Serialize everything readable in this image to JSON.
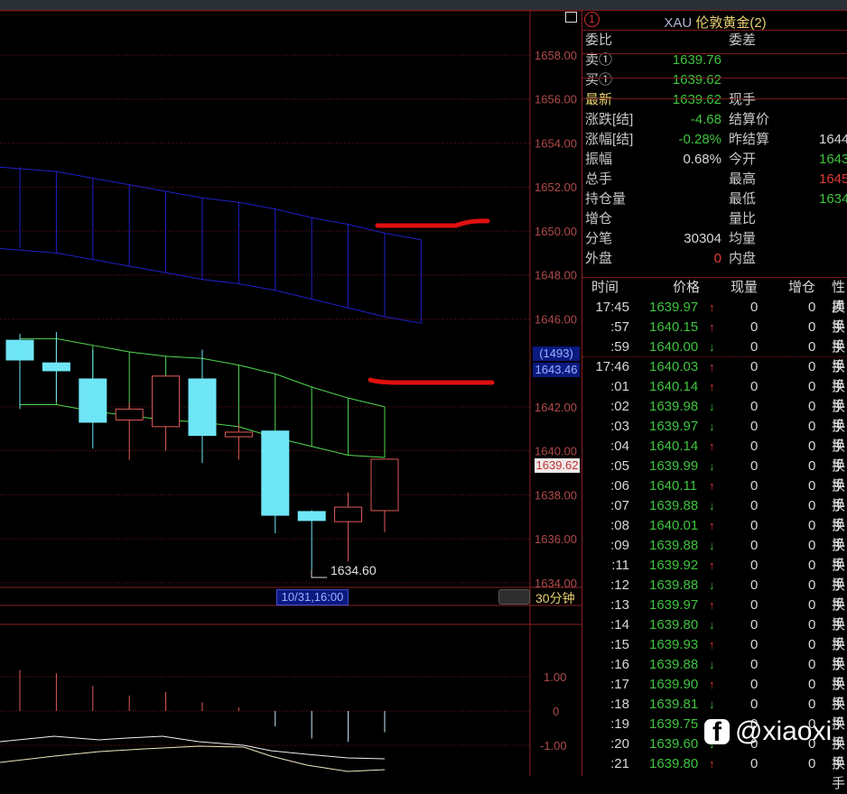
{
  "header": {
    "instrument_title_code": "XAU",
    "instrument_title_name": "伦敦黄金(2)",
    "window_index": "1"
  },
  "quote": {
    "rows": [
      {
        "l": "委比",
        "v": "",
        "l2": "委差",
        "v2": ""
      },
      {
        "l": "卖①",
        "v": "1639.76",
        "l2": "",
        "v2": ""
      },
      {
        "l": "买①",
        "v": "1639.62",
        "l2": "",
        "v2": ""
      },
      {
        "l": "最新",
        "v": "1639.62",
        "l2": "现手",
        "v2": ""
      },
      {
        "l": "涨跌[结]",
        "v": "-4.68",
        "l2": "结算价",
        "v2": ""
      },
      {
        "l": "涨幅[结]",
        "v": "-0.28%",
        "l2": "昨结算",
        "v2": "1644"
      },
      {
        "l": "振幅",
        "v": "0.68%",
        "l2": "今开",
        "v2": "1643"
      },
      {
        "l": "总手",
        "v": "",
        "l2": "最高",
        "v2": "1645"
      },
      {
        "l": "持仓量",
        "v": "",
        "l2": "最低",
        "v2": "1634"
      },
      {
        "l": "增仓",
        "v": "",
        "l2": "量比",
        "v2": ""
      },
      {
        "l": "分笔",
        "v": "30304",
        "l2": "均量",
        "v2": ""
      },
      {
        "l": "外盘",
        "v": "0",
        "l2": "内盘",
        "v2": ""
      }
    ]
  },
  "trades": {
    "headers": [
      "时间",
      "价格",
      "现量",
      "增仓",
      "性质"
    ],
    "rows": [
      [
        "17:45",
        "1639.97",
        "↑",
        "0",
        "0",
        "换手"
      ],
      [
        ":57",
        "1640.15",
        "↑",
        "0",
        "0",
        "换手"
      ],
      [
        ":59",
        "1640.00",
        "↓",
        "0",
        "0",
        "换手"
      ],
      [
        "17:46",
        "1640.03",
        "↑",
        "0",
        "0",
        "换手"
      ],
      [
        ":01",
        "1640.14",
        "↑",
        "0",
        "0",
        "换手"
      ],
      [
        ":02",
        "1639.98",
        "↓",
        "0",
        "0",
        "换手"
      ],
      [
        ":03",
        "1639.97",
        "↓",
        "0",
        "0",
        "换手"
      ],
      [
        ":04",
        "1640.14",
        "↑",
        "0",
        "0",
        "换手"
      ],
      [
        ":05",
        "1639.99",
        "↓",
        "0",
        "0",
        "换手"
      ],
      [
        ":06",
        "1640.11",
        "↑",
        "0",
        "0",
        "换手"
      ],
      [
        ":07",
        "1639.88",
        "↓",
        "0",
        "0",
        "换手"
      ],
      [
        ":08",
        "1640.01",
        "↑",
        "0",
        "0",
        "换手"
      ],
      [
        ":09",
        "1639.88",
        "↓",
        "0",
        "0",
        "换手"
      ],
      [
        ":11",
        "1639.92",
        "↑",
        "0",
        "0",
        "换手"
      ],
      [
        ":12",
        "1639.88",
        "↓",
        "0",
        "0",
        "换手"
      ],
      [
        ":13",
        "1639.97",
        "↑",
        "0",
        "0",
        "换手"
      ],
      [
        ":14",
        "1639.80",
        "↓",
        "0",
        "0",
        "换手"
      ],
      [
        ":15",
        "1639.93",
        "↑",
        "0",
        "0",
        "换手"
      ],
      [
        ":16",
        "1639.88",
        "↓",
        "0",
        "0",
        "换手"
      ],
      [
        ":17",
        "1639.90",
        "↑",
        "0",
        "0",
        "换手"
      ],
      [
        ":18",
        "1639.81",
        "↓",
        "0",
        "0",
        "换手"
      ],
      [
        ":19",
        "1639.75",
        "↓",
        "0",
        "0",
        "换手"
      ],
      [
        ":20",
        "1639.60",
        "↓",
        "0",
        "0",
        "换手"
      ],
      [
        ":21",
        "1639.80",
        "↑",
        "0",
        "0",
        "换手"
      ]
    ]
  },
  "chart": {
    "price_ticks": [
      "1658.00",
      "1656.00",
      "1654.00",
      "1652.00",
      "1650.00",
      "1648.00",
      "1646.00",
      "1642.00",
      "1640.00",
      "1638.00",
      "1636.00",
      "1634.00"
    ],
    "crosshair_count": "(1493)",
    "crosshair_price": "1643.46",
    "last_price": "1639.62",
    "low_label": "1634.60",
    "time_label": "10/31,16:00",
    "period": "30分钟",
    "candles": [
      [
        1645.03,
        1645.32,
        1641.9,
        1644.13
      ],
      [
        1644.0,
        1645.4,
        1642.24,
        1643.64
      ],
      [
        1643.27,
        1644.6,
        1640.1,
        1641.3
      ],
      [
        1641.4,
        1642.2,
        1639.58,
        1641.9
      ],
      [
        1641.1,
        1643.4,
        1640.0,
        1643.4
      ],
      [
        1643.27,
        1644.6,
        1639.45,
        1640.7
      ],
      [
        1640.64,
        1641.2,
        1639.6,
        1640.85
      ],
      [
        1640.9,
        1640.9,
        1636.25,
        1637.07
      ],
      [
        1637.24,
        1637.3,
        1634.6,
        1636.83
      ],
      [
        1636.78,
        1638.1,
        1634.98,
        1637.44
      ],
      [
        1637.28,
        1639.62,
        1636.3,
        1639.62
      ]
    ],
    "green_upper": [
      1645.1,
      1645.1,
      1644.8,
      1644.5,
      1644.3,
      1644.2,
      1643.9,
      1643.5,
      1642.9,
      1642.4,
      1642.0
    ],
    "green_lower": [
      1642.1,
      1642.1,
      1641.8,
      1641.6,
      1641.4,
      1641.3,
      1641.1,
      1640.6,
      1640.2,
      1639.8,
      1639.7
    ],
    "blue_upper": [
      1652.7,
      1652.4,
      1652.1,
      1651.8,
      1651.5,
      1651.3,
      1651.0,
      1650.6,
      1650.3,
      1649.9,
      1649.6
    ],
    "blue_lower": [
      1649.0,
      1648.7,
      1648.4,
      1648.1,
      1647.8,
      1647.6,
      1647.3,
      1646.9,
      1646.5,
      1646.1,
      1645.8
    ],
    "osc_ticks": [
      "1.00",
      "0",
      "-1.00"
    ],
    "osc_bars": [
      1.2,
      1.1,
      0.73,
      0.45,
      0.55,
      0.25,
      0.1,
      -0.45,
      -0.8,
      -0.9,
      -0.62
    ]
  },
  "watermark": "@xiaoxi",
  "colors": {
    "up": "#e05a5a",
    "down": "#6fe6f6",
    "grid": "#7a1a1a",
    "green_band": "#50d850",
    "blue_band": "#2020c8"
  }
}
